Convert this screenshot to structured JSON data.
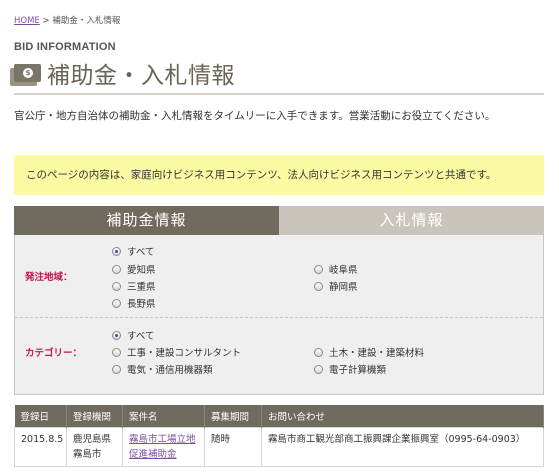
{
  "breadcrumb": {
    "home": "HOME",
    "separator": ">",
    "current": "補助金・入札情報"
  },
  "header": {
    "eyebrow": "BID INFORMATION",
    "title": "補助金・入札情報",
    "icon": "money-icon"
  },
  "lead": "官公庁・地方自治体の補助金・入札情報をタイムリーに入手できます。営業活動にお役立てください。",
  "notice": "このページの内容は、家庭向けビジネス用コンテンツ、法人向けビジネス用コンテンツと共通です。",
  "tabs": [
    {
      "label": "補助金情報",
      "active": true
    },
    {
      "label": "入札情報",
      "active": false
    }
  ],
  "filters": {
    "region": {
      "label": "発注地域：",
      "options": [
        {
          "label": "すべて",
          "checked": true
        },
        {
          "label": "愛知県",
          "checked": false
        },
        {
          "label": "三重県",
          "checked": false
        },
        {
          "label": "長野県",
          "checked": false
        },
        {
          "label": "岐阜県",
          "checked": false
        },
        {
          "label": "静岡県",
          "checked": false
        }
      ]
    },
    "category": {
      "label": "カテゴリー：",
      "options": [
        {
          "label": "すべて",
          "checked": true
        },
        {
          "label": "工事・建設コンサルタント",
          "checked": false
        },
        {
          "label": "電気・通信用機器類",
          "checked": false
        },
        {
          "label": "土木・建設・建築材料",
          "checked": false
        },
        {
          "label": "電子計算機類",
          "checked": false
        }
      ]
    }
  },
  "table": {
    "headers": [
      "登録日",
      "登録機関",
      "案件名",
      "募集期間",
      "お問い合わせ"
    ],
    "rows": [
      {
        "date": "2015.8.5",
        "org_line1": "鹿児島県",
        "org_line2": "霧島市",
        "project_line1": "霧島市工場立地",
        "project_line2": "促進補助金",
        "period": "随時",
        "contact": "霧島市商工観光部商工振興課企業振興室（0995-64-0903）"
      }
    ]
  },
  "colors": {
    "tab_active": "#716a5f",
    "tab_inactive": "#cac5bc",
    "notice_bg": "#fafaa3",
    "label_red": "#c4164c",
    "link": "#7a4fa0"
  }
}
